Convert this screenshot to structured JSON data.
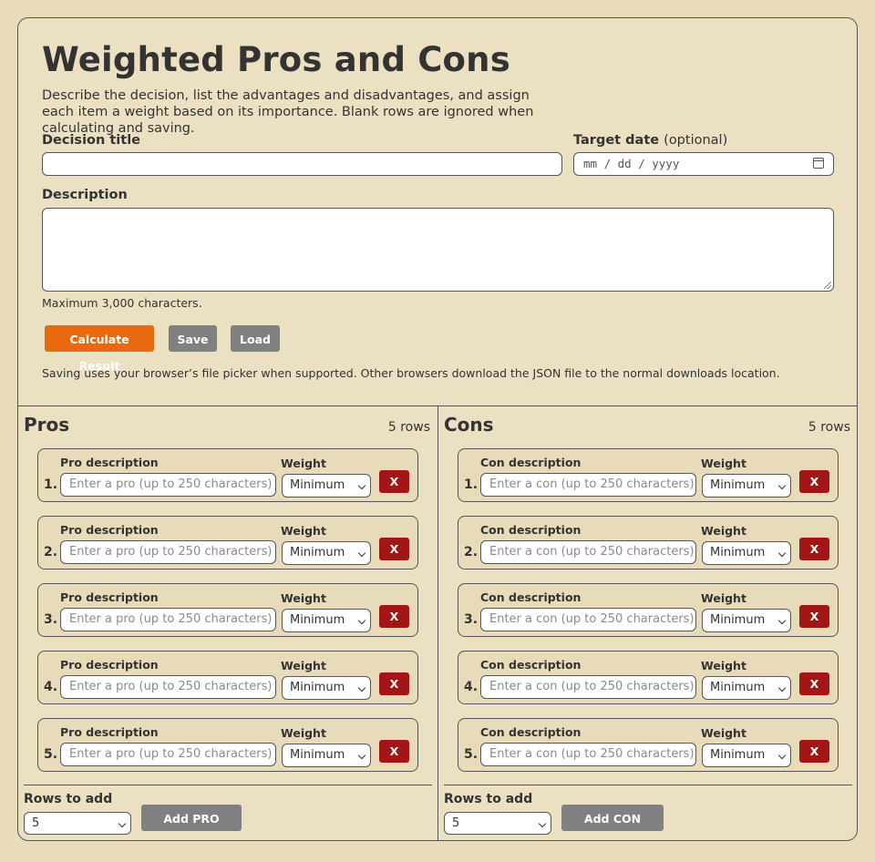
{
  "title": "Weighted Pros and Cons",
  "intro": "Describe the decision, list the advantages and disadvantages, and assign each item a weight based on its importance. Blank rows are ignored when calculating and saving.",
  "form": {
    "decision_title_label": "Decision title",
    "decision_title_value": "",
    "target_date_label": "Target date",
    "target_date_optional": "(optional)",
    "target_date_placeholder": "mm / dd / yyyy",
    "description_label": "Description",
    "description_value": "",
    "max_chars_note": "Maximum 3,000 characters."
  },
  "buttons": {
    "calculate": "Calculate Result",
    "save": "Save",
    "load": "Load"
  },
  "saving_note": "Saving uses your browser’s file picker when supported. Other browsers download the JSON file to the normal downloads location.",
  "colors": {
    "accent": "#e8690e",
    "remove": "#a31616",
    "neutral_button": "#808080",
    "background": "#e8dcbc"
  },
  "pros": {
    "heading": "Pros",
    "row_count": "5 rows",
    "item_label": "Pro description",
    "weight_label": "Weight",
    "placeholder": "Enter a pro (up to 250 characters)",
    "remove_label": "X",
    "items": [
      {
        "num": "1.",
        "weight": "Minimum"
      },
      {
        "num": "2.",
        "weight": "Minimum"
      },
      {
        "num": "3.",
        "weight": "Minimum"
      },
      {
        "num": "4.",
        "weight": "Minimum"
      },
      {
        "num": "5.",
        "weight": "Minimum"
      }
    ],
    "rows_to_add_label": "Rows to add",
    "rows_to_add_value": "5",
    "add_button": "Add PRO Rows"
  },
  "cons": {
    "heading": "Cons",
    "row_count": "5 rows",
    "item_label": "Con description",
    "weight_label": "Weight",
    "placeholder": "Enter a con (up to 250 characters)",
    "remove_label": "X",
    "items": [
      {
        "num": "1.",
        "weight": "Minimum"
      },
      {
        "num": "2.",
        "weight": "Minimum"
      },
      {
        "num": "3.",
        "weight": "Minimum"
      },
      {
        "num": "4.",
        "weight": "Minimum"
      },
      {
        "num": "5.",
        "weight": "Minimum"
      }
    ],
    "rows_to_add_label": "Rows to add",
    "rows_to_add_value": "5",
    "add_button": "Add CON Rows"
  }
}
